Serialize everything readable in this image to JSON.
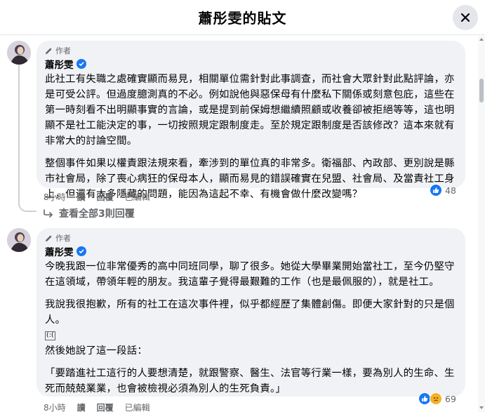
{
  "header": {
    "title": "蕭彤雯的貼文"
  },
  "comments": [
    {
      "role": "作者",
      "author": "蕭彤雯",
      "paragraphs": [
        "此社工有失職之處確實顯而易見，相關單位需針對此事調查，而社會大眾針對此點評論，亦是可受公評。但過度臆測真的不必。例如說他與惡保母有什麼私下關係或刻意包庇，這些在第一時刻看不出明顯事實的言論，或是提到前保姆想繼續照顧或收養卻被拒絕等等，這也明顯不是社工能決定的事，一切按照規定跟制度走。至於規定跟制度是否該修改？這本來就有非常大的討論空間。",
        "整個事件如果以權責跟法規來看，牽涉到的單位真的非常多。衛福部、內政部、更別說是縣市社會局，除了喪心病狂的保母本人，顯而易見的錯誤確實在兒盟、社會局、及當責社工身上，但還有太多隱藏的問題，能因為這起不幸、有機會做什麼改變嗎？"
      ],
      "time": "8小時",
      "read": "讀",
      "reply": "回覆",
      "edited": "已編輯",
      "reaction_count": "48"
    },
    {
      "role": "作者",
      "author": "蕭彤雯",
      "paragraphs": [
        "今晚我跟一位非常優秀的高中同班同學，聊了很多。她從大學畢業開始當社工，至今仍堅守在這領域，帶領年輕的朋友。我這輩子覺得最艱難的工作（也是最佩服的），就是社工。",
        "我說我很抱歉，所有的社工在這次事件裡，似乎都經歷了集體創傷。即便大家針對的只是個人。"
      ],
      "emoji_text": "(:(",
      "paragraph_after": "然後她說了這一段話：",
      "quote": "「要踏進社工這行的人要想清楚，就跟警察、醫生、法官等行業一樣，要為別人的生命、生死而兢兢業業，也會被檢視必須為別人的生死負責。」",
      "time": "8小時",
      "read": "讀",
      "reply": "回覆",
      "edited": "已編輯",
      "reaction_count": "69"
    }
  ],
  "view_replies": "查看全部3則回覆",
  "icons": {
    "close": "close-icon",
    "pencil": "pencil-icon",
    "verified": "verified-badge-icon",
    "like": "like-icon",
    "sad": "sad-icon",
    "reply_arrow": "reply-arrow-icon"
  },
  "colors": {
    "bubble": "#f0f2f5",
    "like": "#1877f2",
    "secondary": "#65676b"
  }
}
